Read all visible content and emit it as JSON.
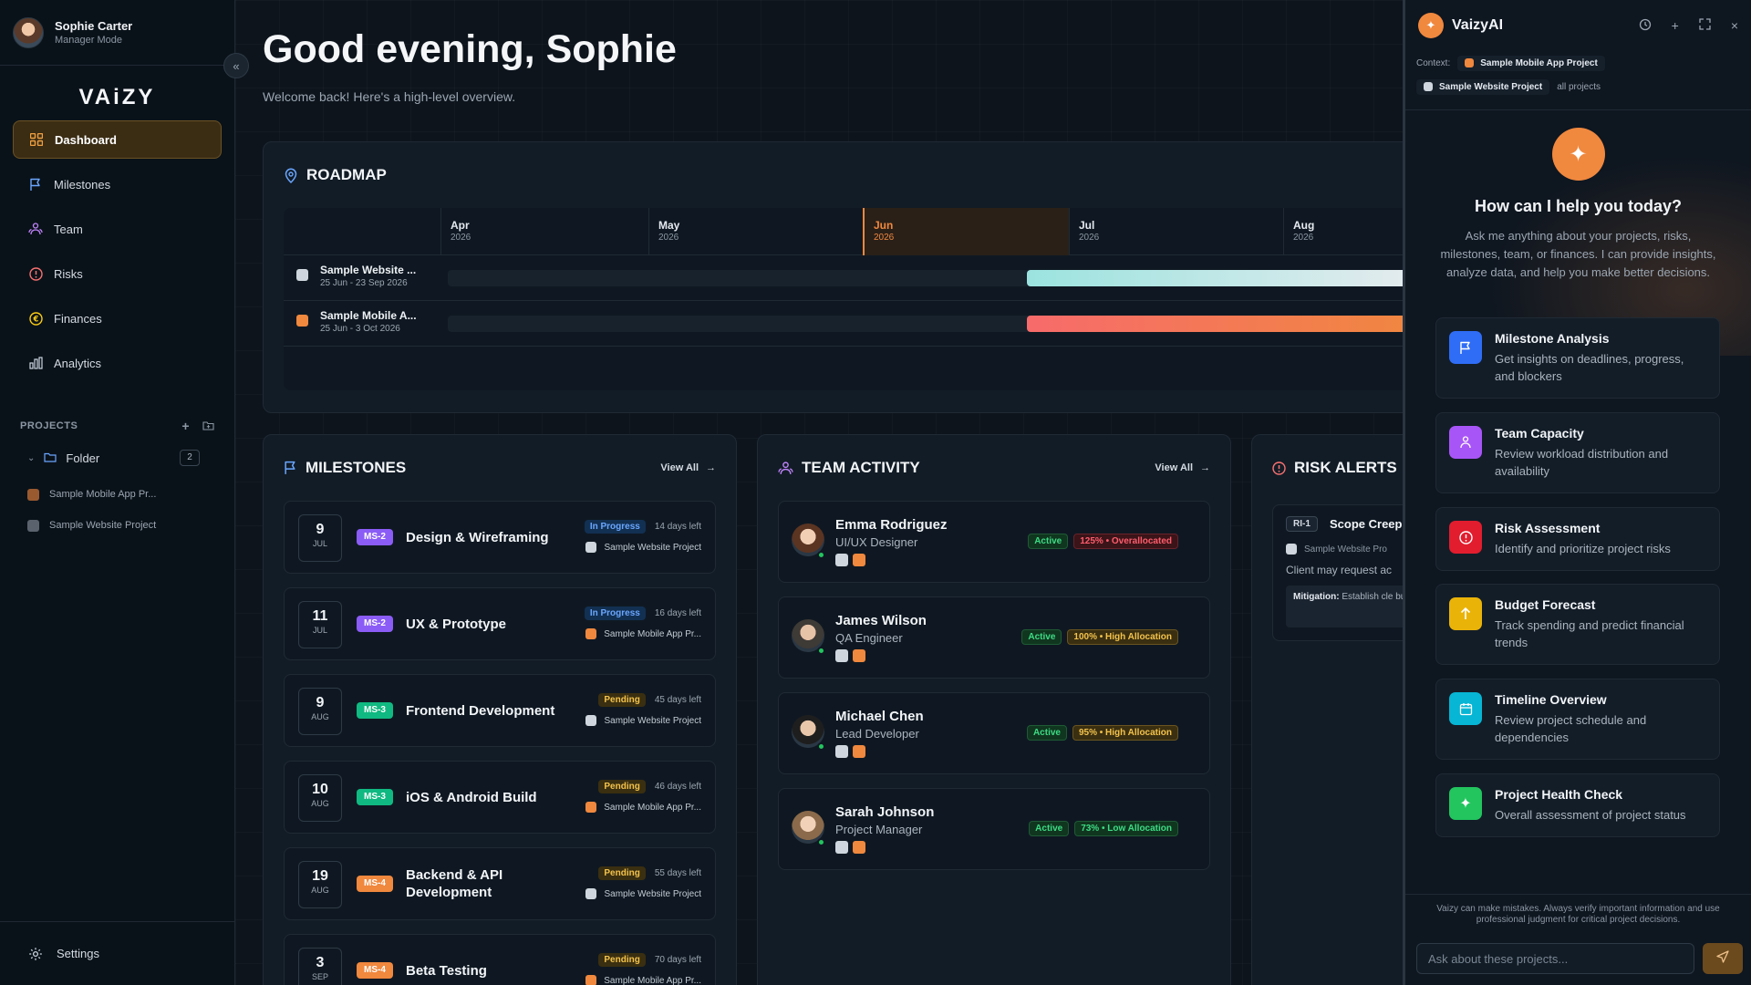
{
  "user": {
    "name": "Sophie Carter",
    "mode": "Manager Mode"
  },
  "brand": {
    "logo": "VAiZY",
    "accent": "#f0883e"
  },
  "nav": [
    {
      "label": "Dashboard",
      "icon": "grid-icon",
      "active": true
    },
    {
      "label": "Milestones",
      "icon": "flag-icon"
    },
    {
      "label": "Team",
      "icon": "team-icon"
    },
    {
      "label": "Risks",
      "icon": "alert-circle-icon"
    },
    {
      "label": "Finances",
      "icon": "coin-icon"
    },
    {
      "label": "Analytics",
      "icon": "bar-chart-icon"
    }
  ],
  "projects": {
    "heading": "PROJECTS",
    "folder": {
      "label": "Folder",
      "count": "2"
    },
    "items": [
      {
        "label": "Sample Mobile App Pr...",
        "color": "#f0883e"
      },
      {
        "label": "Sample Website Project",
        "color": "#cfd6dd"
      }
    ]
  },
  "settings_label": "Settings",
  "header": {
    "greeting": "Good evening, Sophie",
    "subtitle": "Welcome back! Here's a high-level overview."
  },
  "roadmap": {
    "title": "ROADMAP",
    "months": [
      {
        "m": "Apr",
        "y": "2026",
        "current": false
      },
      {
        "m": "May",
        "y": "2026",
        "current": false
      },
      {
        "m": "Jun",
        "y": "2026",
        "current": true
      },
      {
        "m": "Jul",
        "y": "2026",
        "current": false
      },
      {
        "m": "Aug",
        "y": "2026",
        "current": false
      }
    ],
    "rows": [
      {
        "name": "Sample Website ...",
        "dates": "25 Jun - 23 Sep 2026",
        "color": "#cfd6dd",
        "bar": "linear-gradient(90deg,#9be3df,#e8ecef)"
      },
      {
        "name": "Sample Mobile A...",
        "dates": "25 Jun - 3 Oct 2026",
        "color": "#f0883e",
        "bar": "linear-gradient(90deg,#f76b6b,#f0883e)"
      }
    ]
  },
  "milestones": {
    "title": "MILESTONES",
    "view_all": "View All",
    "items": [
      {
        "day": "9",
        "mon": "JUL",
        "tag": "MS-2",
        "tag_color": "#8b5cf6",
        "title": "Design & Wireframing",
        "status": "In Progress",
        "status_type": "progress",
        "left": "14 days left",
        "project": "Sample Website Project",
        "proj_color": "#cfd6dd"
      },
      {
        "day": "11",
        "mon": "JUL",
        "tag": "MS-2",
        "tag_color": "#8b5cf6",
        "title": "UX & Prototype",
        "status": "In Progress",
        "status_type": "progress",
        "left": "16 days left",
        "project": "Sample Mobile App Pr...",
        "proj_color": "#f0883e"
      },
      {
        "day": "9",
        "mon": "AUG",
        "tag": "MS-3",
        "tag_color": "#10b981",
        "title": "Frontend Development",
        "status": "Pending",
        "status_type": "pending",
        "left": "45 days left",
        "project": "Sample Website Project",
        "proj_color": "#cfd6dd"
      },
      {
        "day": "10",
        "mon": "AUG",
        "tag": "MS-3",
        "tag_color": "#10b981",
        "title": "iOS & Android Build",
        "status": "Pending",
        "status_type": "pending",
        "left": "46 days left",
        "project": "Sample Mobile App Pr...",
        "proj_color": "#f0883e"
      },
      {
        "day": "19",
        "mon": "AUG",
        "tag": "MS-4",
        "tag_color": "#f0883e",
        "title": "Backend & API Development",
        "status": "Pending",
        "status_type": "pending",
        "left": "55 days left",
        "project": "Sample Website Project",
        "proj_color": "#cfd6dd"
      },
      {
        "day": "3",
        "mon": "SEP",
        "tag": "MS-4",
        "tag_color": "#f0883e",
        "title": "Beta Testing",
        "status": "Pending",
        "status_type": "pending",
        "left": "70 days left",
        "project": "Sample Mobile App Pr...",
        "proj_color": "#f0883e"
      }
    ]
  },
  "team": {
    "title": "TEAM ACTIVITY",
    "view_all": "View All",
    "members": [
      {
        "name": "Emma Rodriguez",
        "role": "UI/UX Designer",
        "status": "Active",
        "alloc": "125% • Overallocated",
        "alloc_type": "over",
        "avatar": "#8a5a44"
      },
      {
        "name": "James Wilson",
        "role": "QA Engineer",
        "status": "Active",
        "alloc": "100% • High Allocation",
        "alloc_type": "high",
        "avatar": "#6b7886"
      },
      {
        "name": "Michael Chen",
        "role": "Lead Developer",
        "status": "Active",
        "alloc": "95% • High Allocation",
        "alloc_type": "high",
        "avatar": "#4a5562"
      },
      {
        "name": "Sarah Johnson",
        "role": "Project Manager",
        "status": "Active",
        "alloc": "73% • Low Allocation",
        "alloc_type": "low",
        "avatar": "#a88a6a"
      }
    ]
  },
  "risks": {
    "title": "RISK ALERTS",
    "items": [
      {
        "id": "RI-1",
        "title": "Scope Creep",
        "project": "Sample Website Pro",
        "desc": "Client may request ac",
        "mitigation_label": "Mitigation:",
        "mitigation": "Establish cle budget impacts"
      }
    ]
  },
  "ai": {
    "title": "VaizyAI",
    "context_label": "Context:",
    "contexts": [
      {
        "label": "Sample Mobile App Project",
        "color": "#f0883e"
      },
      {
        "label": "Sample Website Project",
        "color": "#cfd6dd"
      }
    ],
    "all_projects": "all projects",
    "question": "How can I help you today?",
    "intro": "Ask me anything about your projects, risks, milestones, team, or finances. I can provide insights, analyze data, and help you make better decisions.",
    "suggestions": [
      {
        "title": "Milestone Analysis",
        "desc": "Get insights on deadlines, progress, and blockers",
        "color": "#2f6df6",
        "icon": "flag-icon"
      },
      {
        "title": "Team Capacity",
        "desc": "Review workload distribution and availability",
        "color": "#a855f7",
        "icon": "team-icon"
      },
      {
        "title": "Risk Assessment",
        "desc": "Identify and prioritize project risks",
        "color": "#e11d2e",
        "icon": "alert-circle-icon"
      },
      {
        "title": "Budget Forecast",
        "desc": "Track spending and predict financial trends",
        "color": "#eab308",
        "icon": "arrow-up-icon"
      },
      {
        "title": "Timeline Overview",
        "desc": "Review project schedule and dependencies",
        "color": "#06b6d4",
        "icon": "calendar-icon"
      },
      {
        "title": "Project Health Check",
        "desc": "Overall assessment of project status",
        "color": "#22c55e",
        "icon": "sparkle-icon"
      }
    ],
    "disclaimer": "Vaizy can make mistakes. Always verify important information and use professional judgment for critical project decisions.",
    "input_placeholder": "Ask about these projects..."
  }
}
